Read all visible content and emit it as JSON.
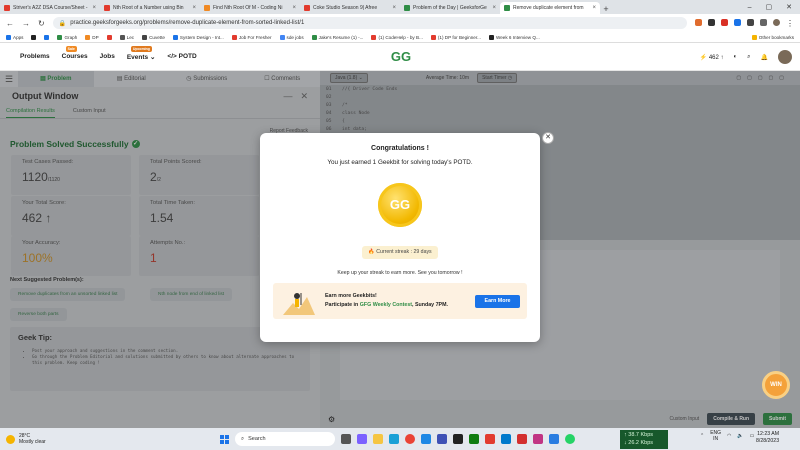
{
  "browser": {
    "tabs": [
      {
        "label": "Striver's A2Z DSA Course/Sheet -",
        "color": "#e23b2e"
      },
      {
        "label": "Nth Root of a Number using Bin",
        "color": "#e23b2e"
      },
      {
        "label": "Find Nth Root Of M - Coding Ni",
        "color": "#f08a24"
      },
      {
        "label": "Coke Studio Season 9| Afree",
        "color": "#e23b2e"
      },
      {
        "label": "Problem of the Day | GeeksforGe",
        "color": "#2f8d46"
      },
      {
        "label": "Remove duplicate element from",
        "color": "#2f8d46"
      }
    ],
    "url": "practice.geeksforgeeks.org/problems/remove-duplicate-element-from-sorted-linked-list/1",
    "bookmarks": [
      "Apps",
      "Graph",
      "DP",
      "Lec",
      "Cuvette",
      "System Design - Int...",
      "Job For Fresher",
      "sde jobs",
      "Jake's Resume (1) -...",
      "(1) CodeHelp - by B...",
      "(1) DP for Beginner...",
      "Week 6 Interview Q..."
    ],
    "other_bookmarks": "Other bookmarks"
  },
  "gfg": {
    "nav": [
      "Problems",
      "Courses",
      "Jobs",
      "Events",
      "POTD"
    ],
    "course_badge": "Sale",
    "events_badge": "Upcoming",
    "logo": "GG",
    "streak_count": "462"
  },
  "left": {
    "tabs": [
      "Problem",
      "Editorial",
      "Submissions",
      "Comments"
    ],
    "output_title": "Output Window",
    "subtabs": [
      "Compilation Results",
      "Custom Input"
    ],
    "report": "Report Feedback",
    "solved": "Problem Solved Successfully",
    "stats": [
      {
        "label": "Test Cases Passed:",
        "value": "1120",
        "suffix": "/1120"
      },
      {
        "label": "Total Points Scored:",
        "value": "2",
        "suffix": "/2"
      },
      {
        "label": "Your Total Score:",
        "value": "462"
      },
      {
        "label": "Total Time Taken:",
        "value": "1.54"
      },
      {
        "label": "Your Accuracy:",
        "value": "100%"
      },
      {
        "label": "Attempts No.:",
        "value": "1"
      }
    ],
    "next_suggested": "Next Suggested Problem(s):",
    "suggested": [
      "Remove duplicates from an unsorted linked list",
      "Nth node from end of linked list",
      "Reverse both parts"
    ],
    "geek_tip_title": "Geek Tip:",
    "geek_tips": [
      "Post your approach and suggestions in the comment section.",
      "Go through the Problem Editorial and solutions submitted by others to know about alternate approaches to this problem. Keep coding !"
    ]
  },
  "editor": {
    "language": "Java (1.8)",
    "avg_time": "Average Time: 10m",
    "timer": "Start Timer",
    "lines": [
      "01",
      "02",
      "03",
      "04",
      "05",
      "06",
      "07"
    ],
    "code": [
      "//{ Driver Code Ends",
      "",
      "/*",
      "class Node",
      "{",
      "    int data;",
      "    Node next;"
    ],
    "custom_input": "Custom Input",
    "compile": "Compile & Run",
    "submit": "Submit"
  },
  "modal": {
    "title": "Congratulations !",
    "subtitle": "You just earned 1 Geekbit for solving today's POTD.",
    "coin": "GG",
    "streak": "Current streak : 29 days",
    "keep": "Keep up your streak to earn more. See you tomorrow !",
    "banner_line1": "Earn more Geekbits!",
    "banner_prefix": "Participate in ",
    "banner_highlight": "GFG Weekly Contest",
    "banner_suffix": ", Sunday 7PM.",
    "earn_btn": "Earn More"
  },
  "win_badge": "WIN",
  "taskbar": {
    "temp": "28°C",
    "weather": "Mostly clear",
    "search": "Search",
    "net_up": "38.7 Kbps",
    "net_down": "26.2 Kbps",
    "lang": "ENG",
    "region": "IN",
    "time": "12:23 AM",
    "date": "8/28/2023"
  }
}
